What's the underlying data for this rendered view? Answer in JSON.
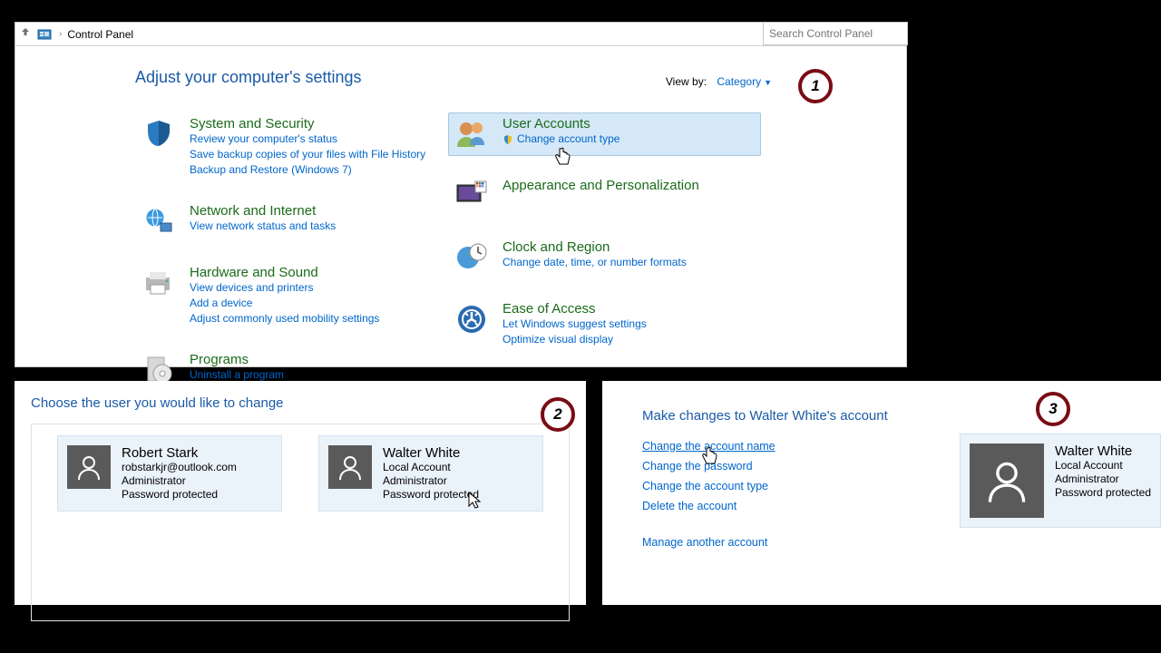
{
  "addr": {
    "location": "Control Panel",
    "search_placeholder": "Search Control Panel"
  },
  "p1": {
    "title": "Adjust your computer's settings",
    "viewby_label": "View by:",
    "viewby_value": "Category",
    "left": [
      {
        "title": "System and Security",
        "links": [
          "Review your computer's status",
          "Save backup copies of your files with File History",
          "Backup and Restore (Windows 7)"
        ]
      },
      {
        "title": "Network and Internet",
        "links": [
          "View network status and tasks"
        ]
      },
      {
        "title": "Hardware and Sound",
        "links": [
          "View devices and printers",
          "Add a device",
          "Adjust commonly used mobility settings"
        ]
      },
      {
        "title": "Programs",
        "links": [
          "Uninstall a program"
        ]
      }
    ],
    "right": [
      {
        "title": "User Accounts",
        "links": [
          "Change account type"
        ],
        "highlight": true,
        "shield": true
      },
      {
        "title": "Appearance and Personalization",
        "links": []
      },
      {
        "title": "Clock and Region",
        "links": [
          "Change date, time, or number formats"
        ]
      },
      {
        "title": "Ease of Access",
        "links": [
          "Let Windows suggest settings",
          "Optimize visual display"
        ]
      }
    ]
  },
  "p2": {
    "title": "Choose the user you would like to change",
    "users": [
      {
        "name": "Robert Stark",
        "email": "robstarkjr@outlook.com",
        "role": "Administrator",
        "pw": "Password protected"
      },
      {
        "name": "Walter White",
        "type": "Local Account",
        "role": "Administrator",
        "pw": "Password protected"
      }
    ]
  },
  "p3": {
    "title": "Make changes to Walter White's account",
    "links": [
      "Change the account name",
      "Change the password",
      "Change the account type",
      "Delete the account"
    ],
    "extra_link": "Manage another account",
    "user": {
      "name": "Walter White",
      "type": "Local Account",
      "role": "Administrator",
      "pw": "Password protected"
    }
  },
  "badges": {
    "1": "1",
    "2": "2",
    "3": "3"
  }
}
